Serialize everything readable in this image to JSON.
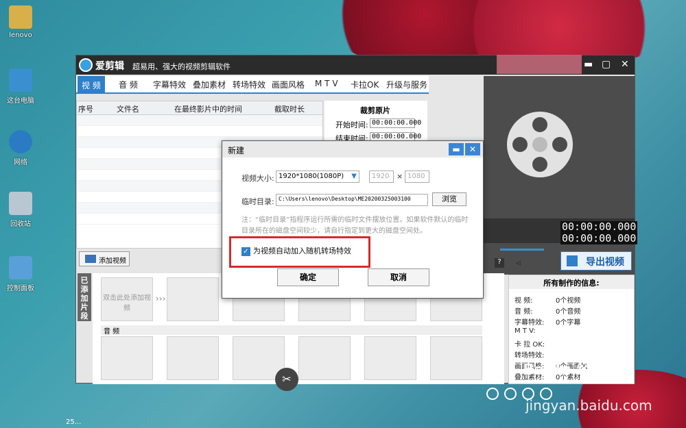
{
  "desktop": {
    "icons": [
      {
        "label": "lenovo",
        "color": "#d8b04a"
      },
      {
        "label": "这台电脑",
        "color": "#3a8fd1"
      },
      {
        "label": "网络",
        "color": "#2a7bc4"
      },
      {
        "label": "回收站",
        "color": "#b9c7d2"
      },
      {
        "label": "控制面板",
        "color": "#5aa0d8"
      }
    ],
    "clock_fragment": "25..."
  },
  "app": {
    "name": "爱剪辑",
    "slogan": "超易用、强大的视频剪辑软件",
    "controls": {
      "min": "▬",
      "max": "▢",
      "close": "✕"
    },
    "tabs": [
      "视  频",
      "音  频",
      "字幕特效",
      "叠加素材",
      "转场特效",
      "画面风格",
      "M T V",
      "卡拉OK",
      "升级与服务"
    ],
    "grid": {
      "columns": [
        "序号",
        "文件名",
        "在最终影片中的时间",
        "截取时长"
      ]
    },
    "crop": {
      "title": "裁剪原片",
      "start_label": "开始时间:",
      "start_value": "00:00:00.000",
      "end_label": "结束时间:",
      "end_value": "00:00:00.000"
    },
    "player": {
      "time1": "00:00:00.000",
      "time2": "00:00:00.000"
    },
    "add_video": "添加视频",
    "export": "导出视频",
    "clips_label": "已添加片段",
    "clip_placeholder": "双击此处添加视频",
    "audio_label": "音  频",
    "info": {
      "title": "所有制作的信息:",
      "rows": [
        {
          "k": "视    频:",
          "v": "0个视频"
        },
        {
          "k": "音    频:",
          "v": "0个音频"
        },
        {
          "k": "字幕特效:",
          "v": "0个字幕"
        },
        {
          "k": "M  T  V:",
          "v": ""
        },
        {
          "k": "卡 拉 OK:",
          "v": ""
        },
        {
          "k": "转场特效:",
          "v": ""
        },
        {
          "k": "画面风格:",
          "v": "0个画面风"
        },
        {
          "k": "叠加素材:",
          "v": "0个素材"
        }
      ]
    }
  },
  "dialog": {
    "title": "新建",
    "size_label": "视频大小:",
    "size_value": "1920*1080(1080P)",
    "width": "1920",
    "times": "×",
    "height": "1080",
    "dir_label": "临时目录:",
    "dir_value": "C:\\Users\\lenovo\\Desktop\\ME20200325003100",
    "browse": "浏览",
    "note": "注：“临时目录”指程序运行所需的临时文件摆放位置。如果软件默认的临时目录所在的磁盘空间较少，请自行指定到更大的磁盘空间处。",
    "checkbox": "为视频自动加入随机转场特效",
    "checked": true,
    "ok": "确定",
    "cancel": "取消"
  },
  "watermark": {
    "brand": "Baidu 经验",
    "url": "jingyan.baidu.com"
  }
}
